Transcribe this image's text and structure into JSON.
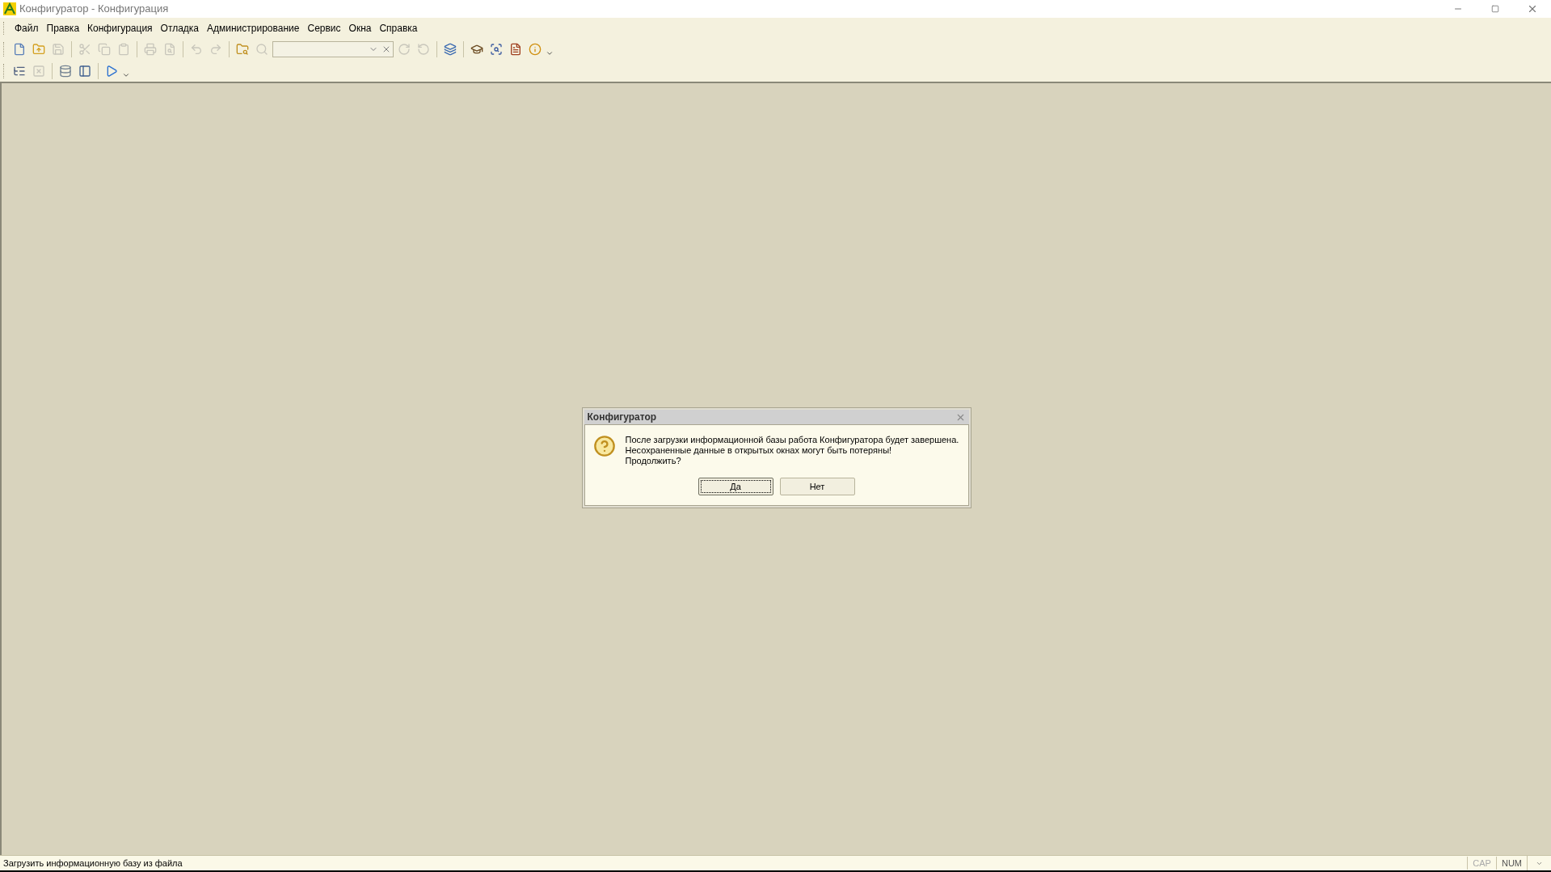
{
  "window": {
    "title": "Конфигуратор - Конфигурация"
  },
  "menu": [
    "Файл",
    "Правка",
    "Конфигурация",
    "Отладка",
    "Администрирование",
    "Сервис",
    "Окна",
    "Справка"
  ],
  "toolbar_1": [
    {
      "kind": "button",
      "disabled": false
    },
    {
      "kind": "button",
      "disabled": false
    },
    {
      "kind": "button",
      "disabled": true
    },
    {
      "kind": "separator"
    },
    {
      "kind": "button",
      "disabled": true
    },
    {
      "kind": "button",
      "disabled": true
    },
    {
      "kind": "button",
      "disabled": true
    },
    {
      "kind": "separator"
    },
    {
      "kind": "button",
      "disabled": true
    },
    {
      "kind": "button",
      "disabled": true
    },
    {
      "kind": "separator"
    },
    {
      "kind": "button",
      "disabled": true
    },
    {
      "kind": "button",
      "disabled": true
    },
    {
      "kind": "separator"
    },
    {
      "kind": "button",
      "disabled": false
    },
    {
      "kind": "button",
      "disabled": true
    },
    {
      "kind": "combo"
    },
    {
      "kind": "button",
      "disabled": true
    },
    {
      "kind": "button",
      "disabled": true
    },
    {
      "kind": "separator"
    },
    {
      "kind": "button",
      "disabled": false
    },
    {
      "kind": "separator"
    },
    {
      "kind": "button",
      "disabled": false
    },
    {
      "kind": "button",
      "disabled": false
    },
    {
      "kind": "button",
      "disabled": false
    },
    {
      "kind": "button",
      "disabled": false
    },
    {
      "kind": "dropdown"
    }
  ],
  "toolbar_2": [
    {
      "kind": "button",
      "disabled": false
    },
    {
      "kind": "button",
      "disabled": true
    },
    {
      "kind": "separator"
    },
    {
      "kind": "button",
      "disabled": false
    },
    {
      "kind": "button",
      "disabled": false
    },
    {
      "kind": "separator"
    },
    {
      "kind": "button",
      "disabled": false
    },
    {
      "kind": "dropdown"
    }
  ],
  "dialog": {
    "title": "Конфигуратор",
    "message": [
      "После загрузки информационной базы работа Конфигуратора будет завершена.",
      "Несохраненные данные в открытых окнах могут быть потеряны!",
      "Продолжить?"
    ],
    "buttons": [
      {
        "label": "Да",
        "selected": true
      },
      {
        "label": "Нет",
        "selected": false
      }
    ]
  },
  "status_bar": {
    "text": "Загрузить информационную базу из файла",
    "indicators": [
      {
        "label": "CAP",
        "on": false
      },
      {
        "label": "NUM",
        "on": true
      }
    ]
  }
}
